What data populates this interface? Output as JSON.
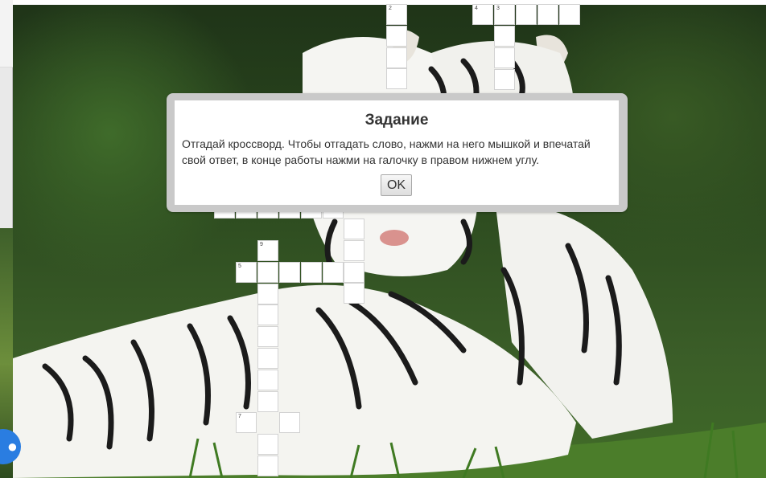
{
  "modal": {
    "title": "Задание",
    "text": "Отгадай кроссворд. Чтобы отгадать слово, нажми на него мышкой и впечатай свой ответ, в конце работы нажми на галочку в правом нижнем углу.",
    "ok_label": "OK"
  },
  "crossword": {
    "clue_numbers": [
      "2",
      "4",
      "3",
      "9",
      "5",
      "7"
    ]
  },
  "chat_widget": {
    "icon": "chat-icon"
  }
}
